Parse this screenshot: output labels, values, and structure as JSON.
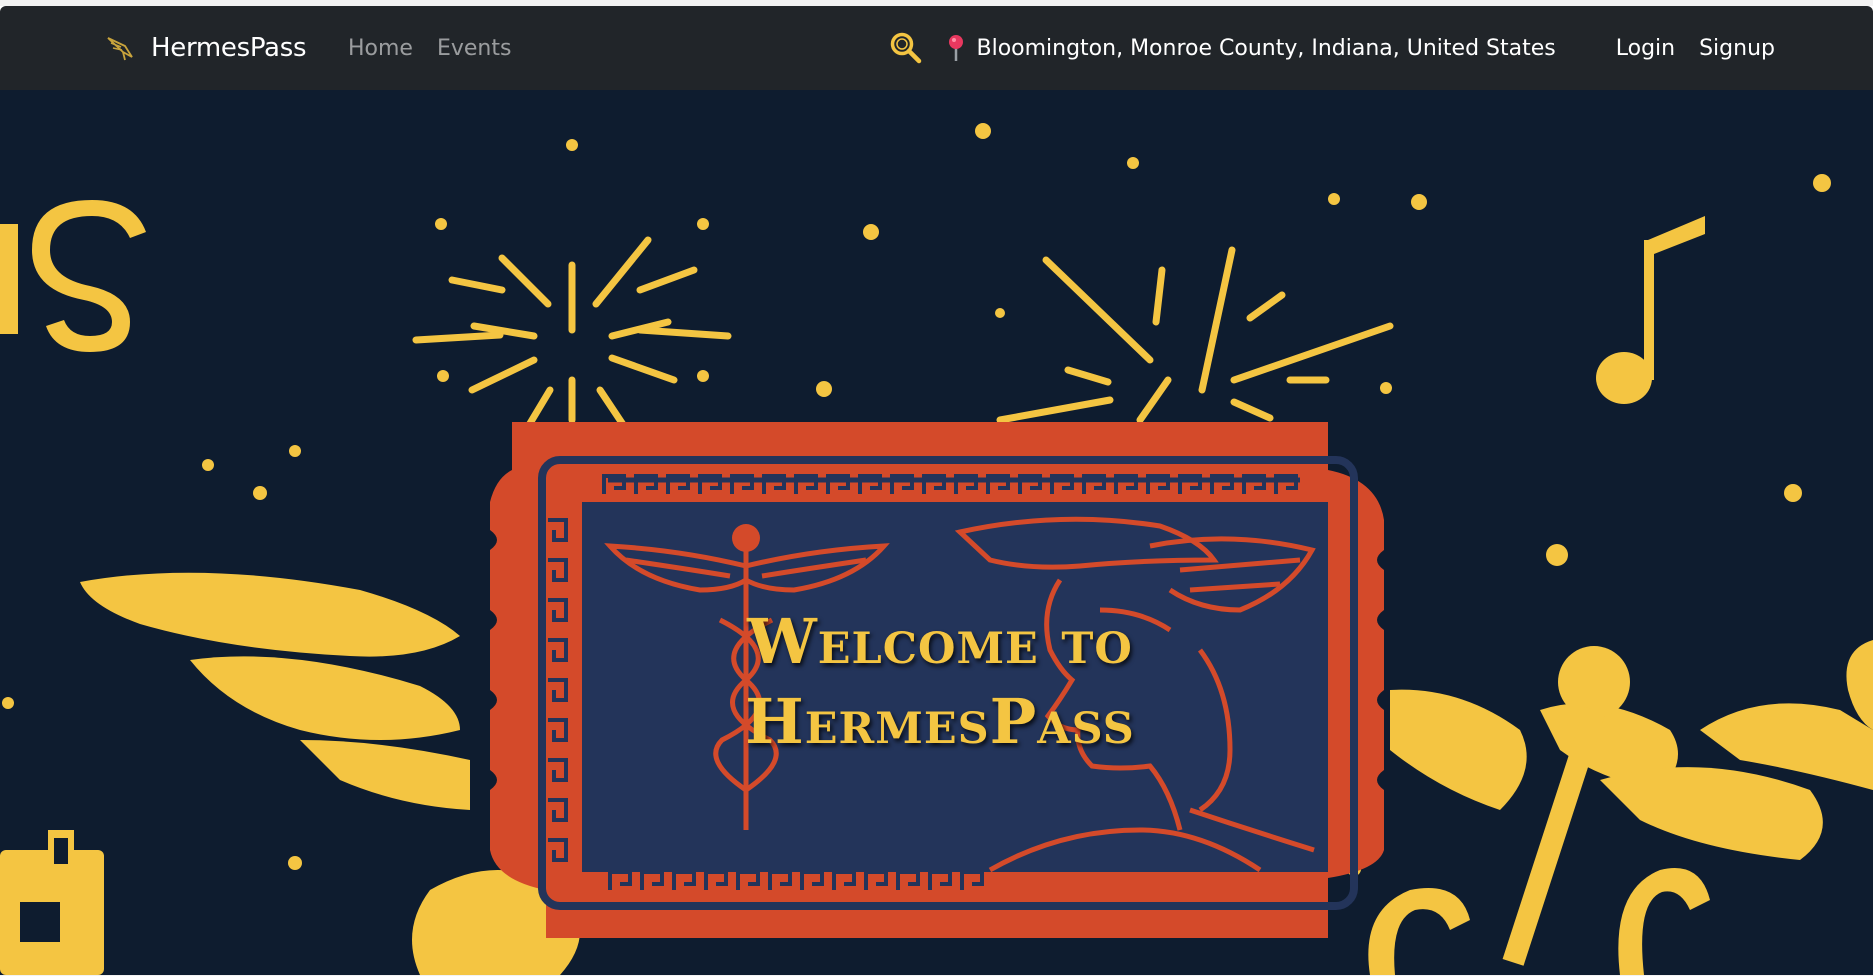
{
  "navbar": {
    "brand": "HermesPass",
    "links": [
      {
        "label": "Home"
      },
      {
        "label": "Events"
      }
    ],
    "search_icon": "search-icon",
    "location_icon": "map-pin-icon",
    "location": "Bloomington, Monroe County, Indiana, United States",
    "login_label": "Login",
    "signup_label": "Signup"
  },
  "hero": {
    "title_line1": "Welcome to",
    "title_line2": "HermesPass"
  },
  "colors": {
    "navbar_bg": "#212529",
    "hero_bg": "#0e1c2f",
    "accent_gold": "#f4c542",
    "ticket_orange": "#d44a2a",
    "ticket_navy": "#23345a"
  }
}
